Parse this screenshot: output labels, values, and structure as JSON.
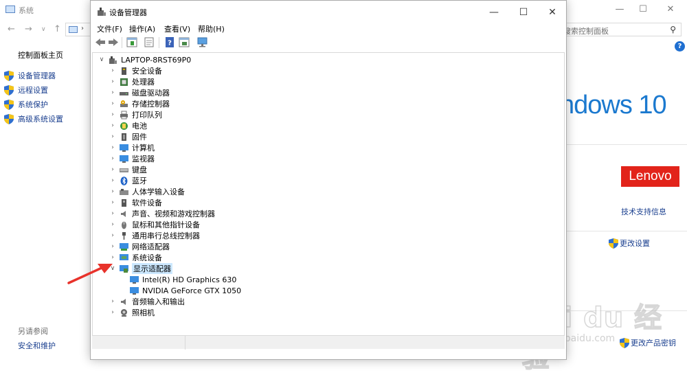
{
  "system_window": {
    "title": "系统",
    "controls": {
      "minimize": "—",
      "maximize": "☐",
      "close": "✕"
    },
    "nav": {
      "back": "←",
      "forward": "→",
      "dropdown": "∨",
      "up": "↑",
      "address_sep": "›"
    },
    "search_placeholder": "搜索控制面板",
    "left_pane": {
      "home": "控制面板主页",
      "links": [
        "设备管理器",
        "远程设置",
        "系统保护",
        "高级系统设置"
      ],
      "see_also": "另请参阅",
      "security": "安全和维护"
    },
    "windows_logo_text": "ndows 10",
    "oem_logo": "Lenovo",
    "support_link": "技术支持信息",
    "change_settings": "更改设置",
    "change_key": "更改产品密钥",
    "watermark": {
      "line1": "Bai du 经验",
      "line2": "jingyan.baidu.com"
    }
  },
  "device_manager": {
    "title": "设备管理器",
    "controls": {
      "minimize": "—",
      "maximize": "☐",
      "close": "✕"
    },
    "menu": {
      "file": "文件(F)",
      "action": "操作(A)",
      "view": "查看(V)",
      "help": "帮助(H)"
    },
    "tree": {
      "root": "LAPTOP-8RST69P0",
      "categories": [
        "安全设备",
        "处理器",
        "磁盘驱动器",
        "存储控制器",
        "打印队列",
        "电池",
        "固件",
        "计算机",
        "监视器",
        "键盘",
        "蓝牙",
        "人体学输入设备",
        "软件设备",
        "声音、视频和游戏控制器",
        "鼠标和其他指针设备",
        "通用串行总线控制器",
        "网络适配器",
        "系统设备",
        "显示适配器"
      ],
      "expanded_children": [
        "Intel(R) HD Graphics 630",
        "NVIDIA GeForce GTX 1050"
      ],
      "after_categories": [
        "音频输入和输出",
        "照相机"
      ]
    }
  },
  "colors": {
    "accent": "#1b79cf",
    "lenovo": "#e2231a",
    "link": "#1a3f8f",
    "selection": "#cce8ff",
    "arrow": "#e8322b"
  }
}
